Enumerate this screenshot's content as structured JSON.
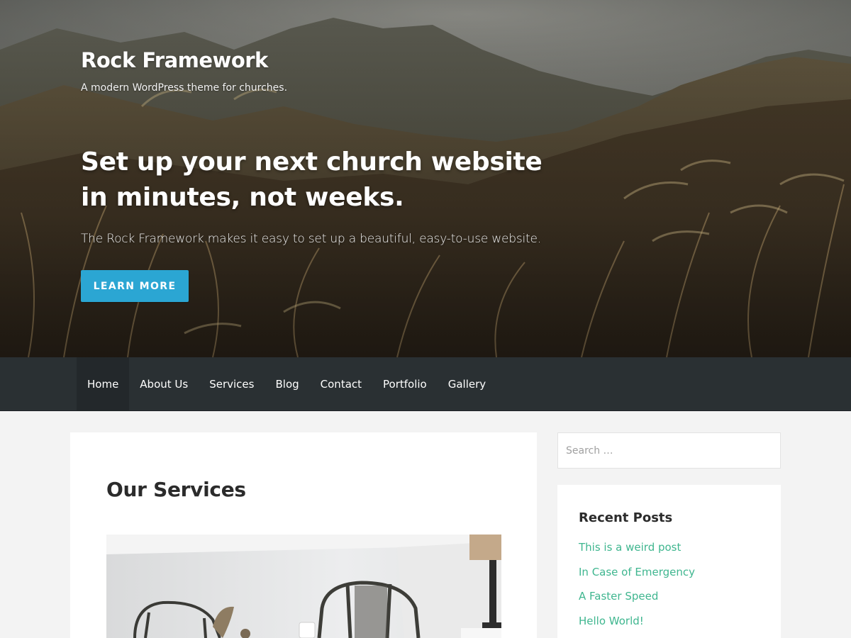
{
  "site": {
    "title": "Rock Framework",
    "tagline": "A modern WordPress theme for churches."
  },
  "hero": {
    "heading": "Set up your next church website in minutes, not weeks.",
    "text": "The Rock Framework makes it easy to set up a beautiful, easy-to-use website.",
    "button_label": "LEARN MORE",
    "background_image": "mountain-grass-landscape"
  },
  "nav": {
    "items": [
      {
        "label": "Home",
        "active": true
      },
      {
        "label": "About Us"
      },
      {
        "label": "Services"
      },
      {
        "label": "Blog"
      },
      {
        "label": "Contact"
      },
      {
        "label": "Portfolio"
      },
      {
        "label": "Gallery"
      }
    ]
  },
  "main": {
    "title": "Our Services",
    "featured_image": "chairs-table-interior"
  },
  "sidebar": {
    "search_placeholder": "Search …",
    "recent_posts": {
      "title": "Recent Posts",
      "items": [
        "This is a weird post",
        "In Case of Emergency",
        "A Faster Speed",
        "Hello World!"
      ]
    }
  },
  "colors": {
    "accent_button": "#2ba6d3",
    "nav_background": "#2a3033",
    "nav_active": "#23282b",
    "link": "#3fb68f",
    "page_background": "#f3f3f3"
  }
}
